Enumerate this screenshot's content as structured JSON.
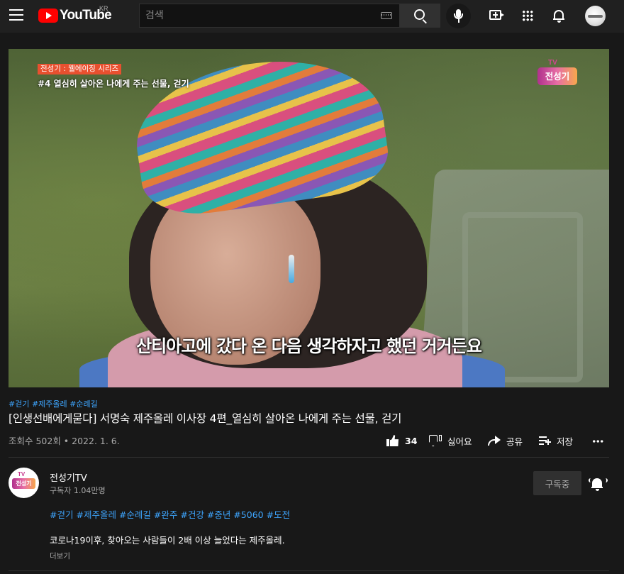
{
  "header": {
    "logo_text": "YouTube",
    "region": "KR",
    "search": {
      "placeholder": "검색",
      "value": ""
    }
  },
  "video": {
    "caption_tag": "전성기 : 웰에이징 시리즈",
    "caption_title": "#4 열심히 살아온 나에게 주는 선물, 걷기",
    "badge_tv": "TV",
    "badge_name": "전성기",
    "subtitle": "산티아고에 갔다 온 다음 생각하자고 했던 거거든요",
    "hashtags_top": [
      "#걷기",
      "#제주올레",
      "#순례길"
    ],
    "title": "[인생선배에게묻다] 서명숙 제주올레 이사장 4편_열심히 살아온 나에게 주는 선물, 걷기",
    "view_info": "조회수 502회 • 2022. 1. 6.",
    "actions": {
      "like_count": "34",
      "dislike_label": "싫어요",
      "share_label": "공유",
      "save_label": "저장"
    }
  },
  "channel": {
    "avatar_tv": "TV",
    "avatar_name": "전성기",
    "name": "전성기TV",
    "subscribers": "구독자 1.04만명",
    "subscribe_label": "구독중"
  },
  "description": {
    "hashtags": [
      "#걷기",
      "#제주올레",
      "#순례길",
      "#완주",
      "#건강",
      "#중년",
      "#5060",
      "#도전"
    ],
    "text": "코로나19이후, 찾아오는 사람들이 2배 이상 늘었다는 제주올레.",
    "show_more": "더보기"
  },
  "colors": {
    "background": "#181818",
    "header": "#202020",
    "link": "#3ea6ff",
    "brand_red": "#ff0000"
  },
  "icons": [
    "menu-icon",
    "youtube-logo-icon",
    "keyboard-icon",
    "search-icon",
    "mic-icon",
    "create-video-icon",
    "apps-icon",
    "notifications-icon",
    "like-icon",
    "dislike-icon",
    "share-icon",
    "save-playlist-icon",
    "more-icon",
    "bell-ringing-icon"
  ]
}
